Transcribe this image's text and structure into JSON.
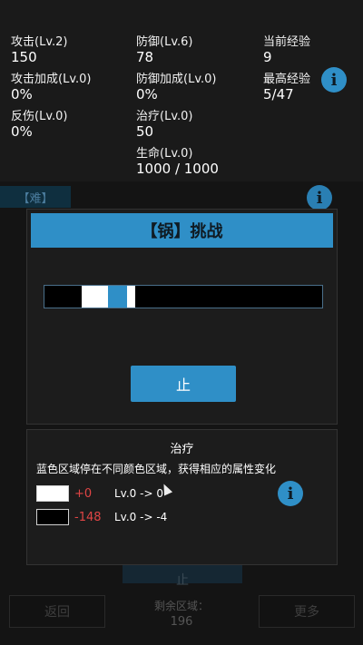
{
  "stats": {
    "attack": {
      "label": "攻击(Lv.2)",
      "value": "150"
    },
    "attack_bonus": {
      "label": "攻击加成(Lv.0)",
      "value": "0%"
    },
    "reflect": {
      "label": "反伤(Lv.0)",
      "value": "0%"
    },
    "defense": {
      "label": "防御(Lv.6)",
      "value": "78"
    },
    "defense_bonus": {
      "label": "防御加成(Lv.0)",
      "value": "0%"
    },
    "heal": {
      "label": "治疗(Lv.0)",
      "value": "50"
    },
    "life": {
      "label": "生命(Lv.0)",
      "value": "1000 / 1000"
    },
    "current_exp": {
      "label": "当前经验",
      "value": "9"
    },
    "max_exp": {
      "label": "最高经验",
      "value": "5/47"
    }
  },
  "icons": {
    "info": "i"
  },
  "background": {
    "difficulty_tag": "【难】",
    "back_button": "返回",
    "more_button": "更多",
    "hidden_stop": "止",
    "remaining_label": "剩余区域：",
    "remaining_value": "196"
  },
  "dialog": {
    "title": "【锅】挑战",
    "stop_button": "止",
    "bar_segments": [
      {
        "color": "#ffffff",
        "start": 0.134,
        "end": 0.229
      },
      {
        "color": "#2f8fc7",
        "start": 0.229,
        "end": 0.297
      },
      {
        "color": "#ffffff",
        "start": 0.297,
        "end": 0.326
      }
    ]
  },
  "info_panel": {
    "title": "治疗",
    "description": "蓝色区域停在不同颜色区域，获得相应的属性变化",
    "legend": [
      {
        "swatch_color": "#ffffff",
        "delta": "+0",
        "change": "Lv.0 -> 0"
      },
      {
        "swatch_color": "#000000",
        "delta": "-148",
        "change": "Lv.0 -> -4"
      }
    ]
  },
  "colors": {
    "accent": "#2f8fc7",
    "negative": "#e04545"
  }
}
